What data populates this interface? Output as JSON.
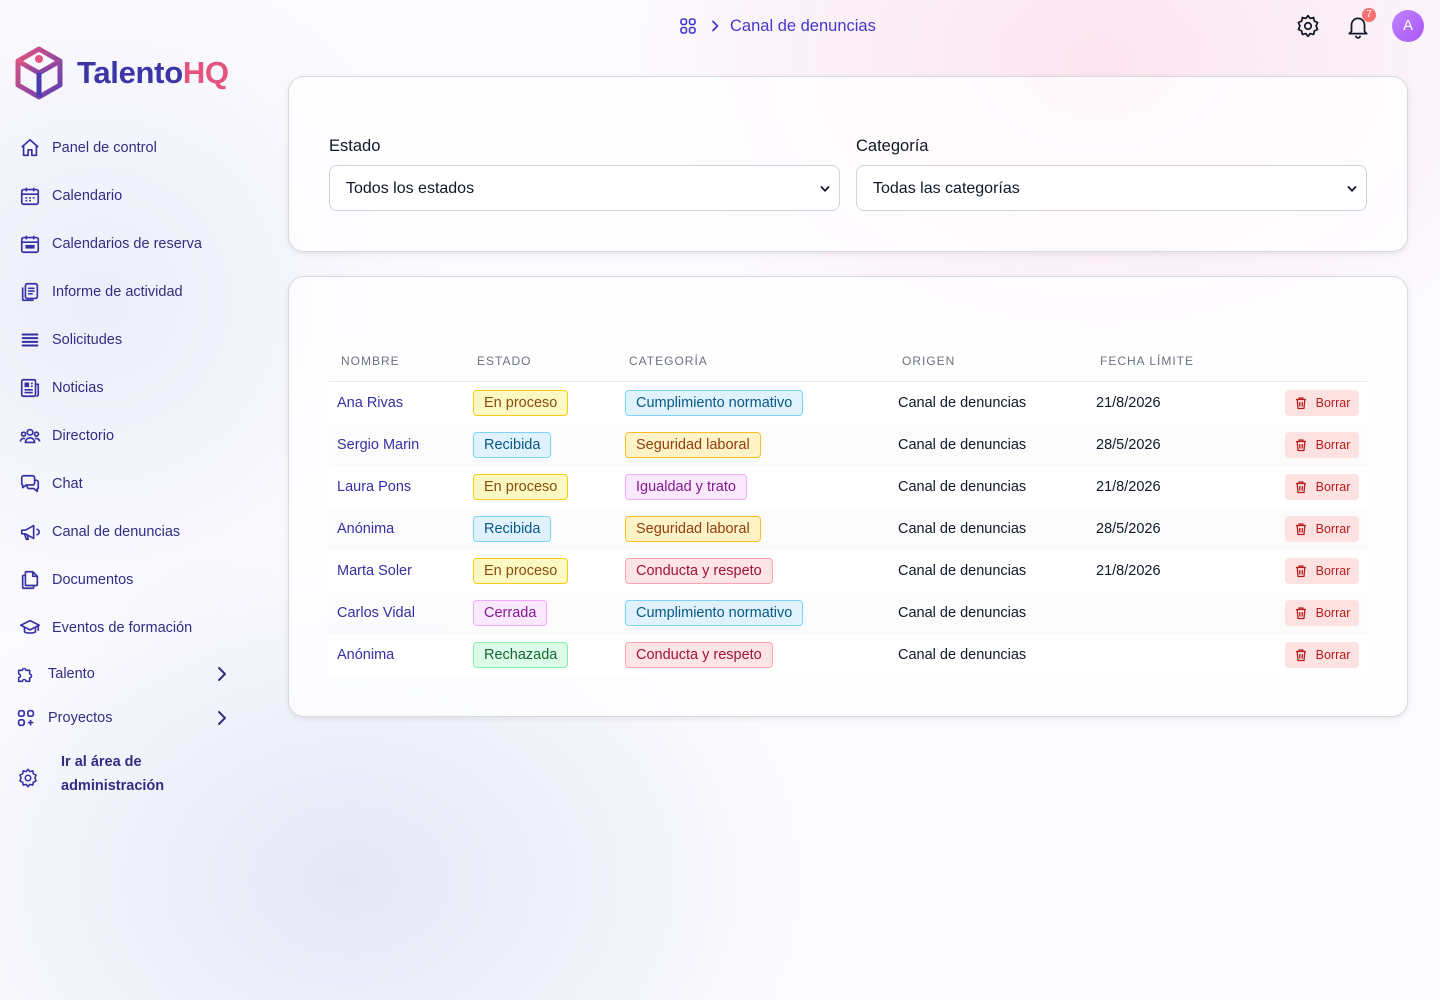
{
  "app": {
    "logo_part1": "Talento",
    "logo_part2": "HQ",
    "brand_colors": {
      "primary": "#3b35a8",
      "accent": "#e5537f"
    }
  },
  "sidebar": {
    "items": [
      {
        "label": "Panel de control",
        "icon": "home-icon"
      },
      {
        "label": "Calendario",
        "icon": "calendar-icon"
      },
      {
        "label": "Calendarios de reserva",
        "icon": "calendar-booking-icon"
      },
      {
        "label": "Informe de actividad",
        "icon": "report-icon"
      },
      {
        "label": "Solicitudes",
        "icon": "list-icon"
      },
      {
        "label": "Noticias",
        "icon": "newspaper-icon"
      },
      {
        "label": "Directorio",
        "icon": "users-icon"
      },
      {
        "label": "Chat",
        "icon": "chat-icon"
      },
      {
        "label": "Canal de denuncias",
        "icon": "megaphone-icon"
      },
      {
        "label": "Documentos",
        "icon": "documents-icon"
      },
      {
        "label": "Eventos de formación",
        "icon": "graduation-cap-icon"
      },
      {
        "label": "Talento",
        "icon": "puzzle-icon"
      },
      {
        "label": "Proyectos",
        "icon": "grid-icon"
      }
    ],
    "admin_label": "Ir al área de administración"
  },
  "header": {
    "breadcrumb": "Canal de denuncias",
    "notification_count": "7",
    "avatar_initial": "A"
  },
  "filters": {
    "estado_label": "Estado",
    "estado_value": "Todos los estados",
    "categoria_label": "Categoría",
    "categoria_value": "Todas las categorías"
  },
  "table": {
    "headers": [
      "NOMBRE",
      "ESTADO",
      "CATEGORÍA",
      "ORIGEN",
      "FECHA LÍMITE"
    ],
    "delete_label": "Borrar",
    "rows": [
      {
        "name": "Ana Rivas",
        "status": "En proceso",
        "category": "Cumplimiento normativo",
        "origin": "Canal de denuncias",
        "due": "21/8/2026"
      },
      {
        "name": "Sergio Marin",
        "status": "Recibida",
        "category": "Seguridad laboral",
        "origin": "Canal de denuncias",
        "due": "28/5/2026"
      },
      {
        "name": "Laura Pons",
        "status": "En proceso",
        "category": "Igualdad y trato",
        "origin": "Canal de denuncias",
        "due": "21/8/2026"
      },
      {
        "name": "Anónima",
        "status": "Recibida",
        "category": "Seguridad laboral",
        "origin": "Canal de denuncias",
        "due": "28/5/2026"
      },
      {
        "name": "Marta Soler",
        "status": "En proceso",
        "category": "Conducta y respeto",
        "origin": "Canal de denuncias",
        "due": "21/8/2026"
      },
      {
        "name": "Carlos Vidal",
        "status": "Cerrada",
        "category": "Cumplimiento normativo",
        "origin": "Canal de denuncias",
        "due": ""
      },
      {
        "name": "Anónima",
        "status": "Rechazada",
        "category": "Conducta y respeto",
        "origin": "Canal de denuncias",
        "due": ""
      }
    ]
  },
  "status_colors": {
    "En proceso": {
      "bg": "#fef9c3",
      "border": "#facc15",
      "fg": "#854d0e"
    },
    "Recibida": {
      "bg": "#e0f2fe",
      "border": "#7dd3fc",
      "fg": "#075985"
    },
    "Cerrada": {
      "bg": "#fae8ff",
      "border": "#f0abfc",
      "fg": "#86198f"
    },
    "Rechazada": {
      "bg": "#dcfce7",
      "border": "#86efac",
      "fg": "#166534"
    }
  },
  "category_colors": {
    "Cumplimiento normativo": {
      "bg": "#e0f2fe",
      "border": "#7dd3fc",
      "fg": "#075985"
    },
    "Seguridad laboral": {
      "bg": "#fef3c7",
      "border": "#fbbf24",
      "fg": "#92400e"
    },
    "Igualdad y trato": {
      "bg": "#fae8ff",
      "border": "#f0abfc",
      "fg": "#86198f"
    },
    "Conducta y respeto": {
      "bg": "#ffe4e6",
      "border": "#fda4af",
      "fg": "#9f1239"
    }
  }
}
